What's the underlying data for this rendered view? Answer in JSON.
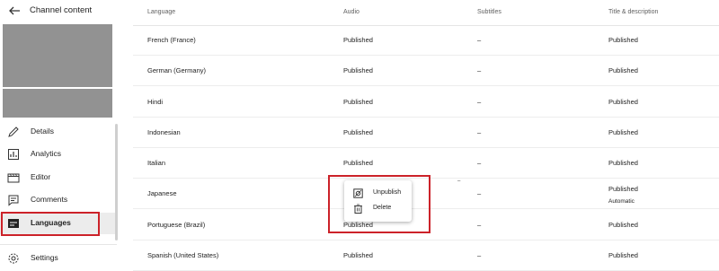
{
  "sidebar": {
    "title": "Channel content",
    "nav": [
      {
        "label": "Details",
        "icon": "pencil-icon"
      },
      {
        "label": "Analytics",
        "icon": "analytics-icon"
      },
      {
        "label": "Editor",
        "icon": "clapperboard-icon"
      },
      {
        "label": "Comments",
        "icon": "comments-icon"
      },
      {
        "label": "Languages",
        "icon": "subtitles-icon",
        "active": true
      }
    ],
    "settings_label": "Settings"
  },
  "table": {
    "headers": [
      "Language",
      "Audio",
      "Subtitles",
      "Title & description"
    ],
    "rows": [
      {
        "language": "French (France)",
        "audio": "Published",
        "subtitles": "–",
        "title": "Published"
      },
      {
        "language": "German (Germany)",
        "audio": "Published",
        "subtitles": "–",
        "title": "Published"
      },
      {
        "language": "Hindi",
        "audio": "Published",
        "subtitles": "–",
        "title": "Published"
      },
      {
        "language": "Indonesian",
        "audio": "Published",
        "subtitles": "–",
        "title": "Published"
      },
      {
        "language": "Italian",
        "audio": "Published",
        "subtitles": "–",
        "title": "Published"
      },
      {
        "language": "Japanese",
        "audio": "",
        "subtitles": "–",
        "title": "Published",
        "title_sub": "Automatic"
      },
      {
        "language": "Portuguese (Brazil)",
        "audio": "Published",
        "subtitles": "–",
        "title": "Published"
      },
      {
        "language": "Spanish (United States)",
        "audio": "Published",
        "subtitles": "–",
        "title": "Published"
      }
    ]
  },
  "menu": {
    "items": [
      {
        "label": "Unpublish",
        "icon": "unpublish-icon"
      },
      {
        "label": "Delete",
        "icon": "trash-icon"
      }
    ],
    "dash_mark": "–"
  },
  "colors": {
    "highlight": "#cc2229",
    "active_bg": "#ececec"
  }
}
